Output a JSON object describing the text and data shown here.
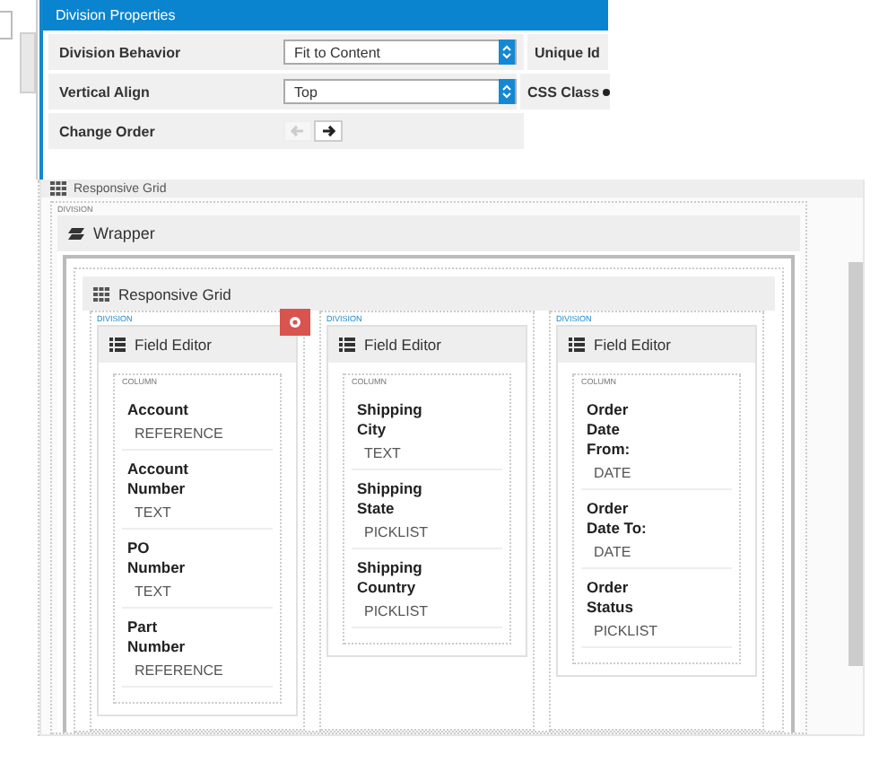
{
  "properties_panel": {
    "title": "Division Properties",
    "rows": [
      {
        "label": "Division Behavior",
        "value": "Fit to Content",
        "side_label": "Unique Id"
      },
      {
        "label": "Vertical Align",
        "value": "Top",
        "side_label": "CSS Class"
      }
    ],
    "change_order": {
      "label": "Change Order",
      "buttons": [
        {
          "kind": "left",
          "disabled": true
        },
        {
          "kind": "right",
          "disabled": false
        }
      ]
    }
  },
  "canvas": {
    "outer_header": "Responsive Grid",
    "division_label": "DIVISION",
    "wrapper": {
      "title": "Wrapper",
      "grid_title": "Responsive Grid",
      "divisions": [
        {
          "label": "DIVISION",
          "title": "Field Editor",
          "column_label": "COLUMN",
          "show_delete": true,
          "fields": [
            {
              "name": "Account",
              "type": "REFERENCE"
            },
            {
              "name": "Account Number",
              "type": "TEXT"
            },
            {
              "name": "PO Number",
              "type": "TEXT"
            },
            {
              "name": "Part Number",
              "type": "REFERENCE"
            }
          ]
        },
        {
          "label": "DIVISION",
          "title": "Field Editor",
          "column_label": "COLUMN",
          "show_delete": false,
          "fields": [
            {
              "name": "Shipping City",
              "type": "TEXT"
            },
            {
              "name": "Shipping State",
              "type": "PICKLIST"
            },
            {
              "name": "Shipping Country",
              "type": "PICKLIST"
            }
          ]
        },
        {
          "label": "DIVISION",
          "title": "Field Editor",
          "column_label": "COLUMN",
          "show_delete": false,
          "fields": [
            {
              "name": "Order Date From:",
              "type": "DATE"
            },
            {
              "name": "Order Date To:",
              "type": "DATE"
            },
            {
              "name": "Order Status",
              "type": "PICKLIST"
            }
          ]
        }
      ]
    }
  }
}
